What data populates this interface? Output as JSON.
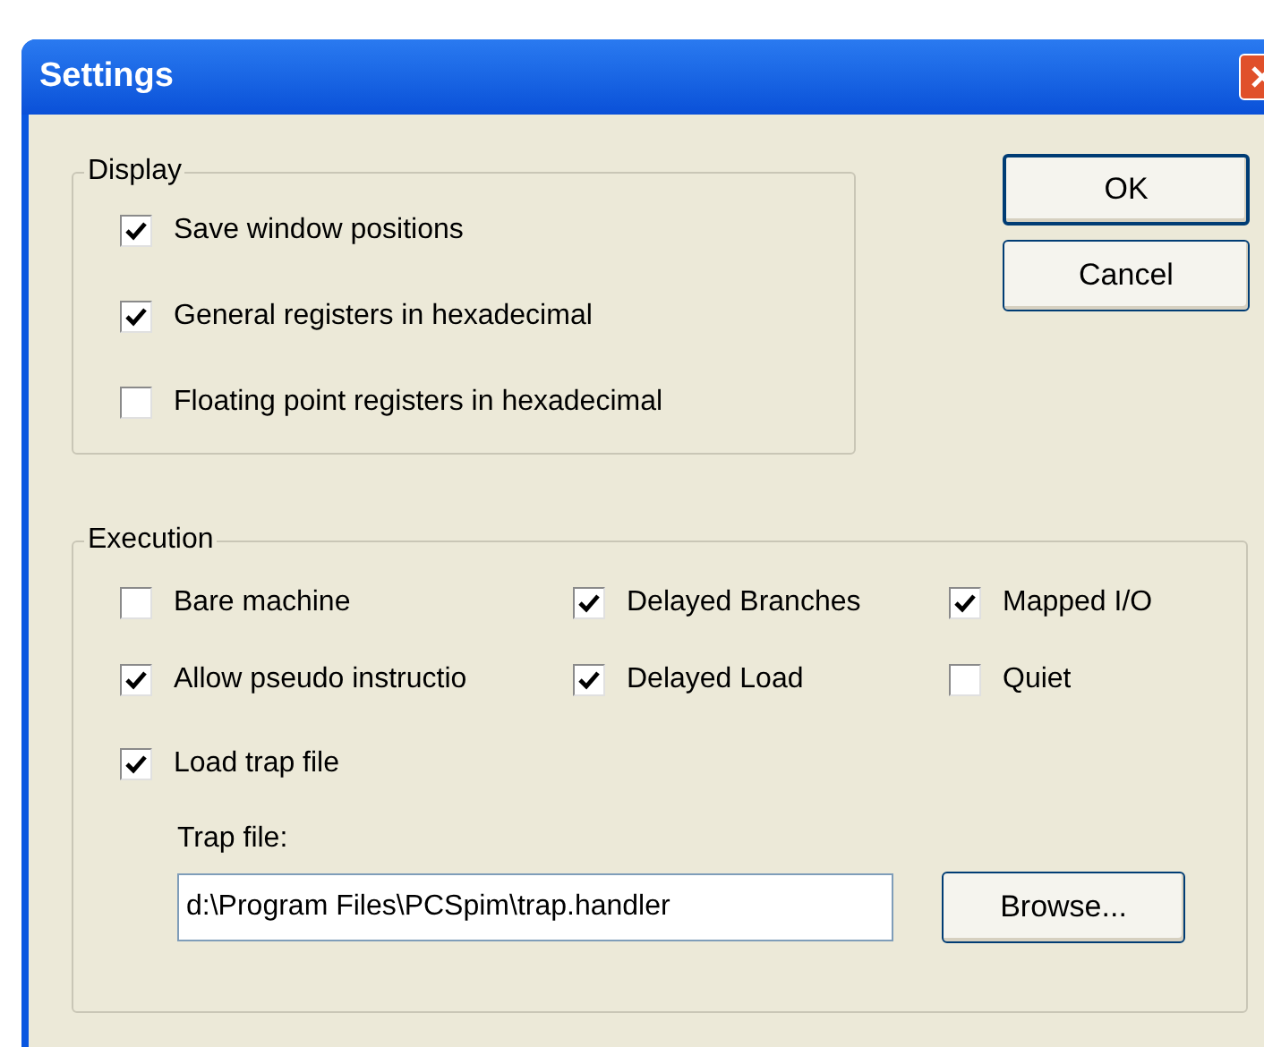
{
  "window": {
    "title": "Settings"
  },
  "display": {
    "title": "Display",
    "options": [
      {
        "label": "Save window positions",
        "checked": true
      },
      {
        "label": "General registers in hexadecimal",
        "checked": true
      },
      {
        "label": "Floating point registers in hexadecimal",
        "checked": false
      }
    ]
  },
  "buttons": [
    "OK",
    "Cancel"
  ],
  "execution": {
    "title": "Execution",
    "options": [
      {
        "label": "Bare machine",
        "checked": false
      },
      {
        "label": "Delayed Branches",
        "checked": true
      },
      {
        "label": "Mapped I/O",
        "checked": true
      },
      {
        "label": "Allow pseudo instructio",
        "checked": true
      },
      {
        "label": "Delayed Load",
        "checked": true
      },
      {
        "label": "Quiet",
        "checked": false
      }
    ],
    "load_trap": {
      "label": "Load trap file",
      "checked": true
    },
    "trap_file": {
      "label": "Trap file:",
      "value": "d:\\Program Files\\PCSpim\\trap.handler"
    },
    "browse_button": "Browse..."
  }
}
